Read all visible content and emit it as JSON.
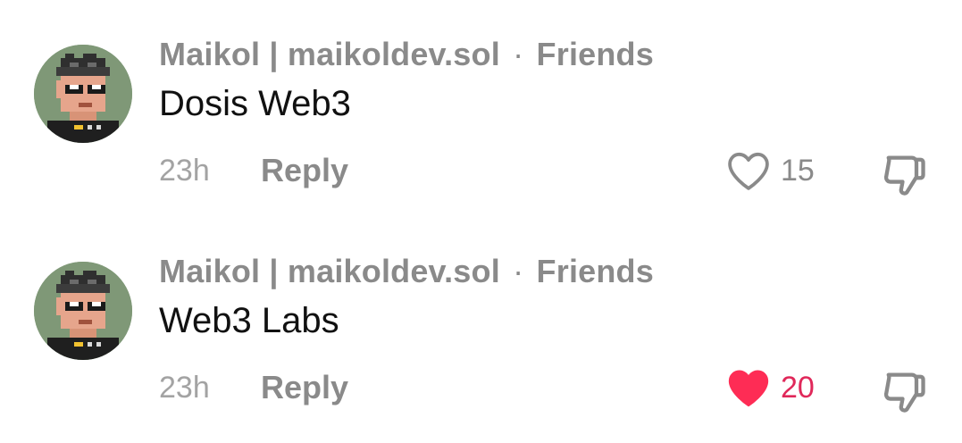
{
  "comments": [
    {
      "author": "Maikol | maikoldev.sol",
      "separator": "·",
      "relation": "Friends",
      "text": "Dosis Web3",
      "time": "23h",
      "reply_label": "Reply",
      "likes": "15",
      "liked": false,
      "avatar_icon": "pixel-art-avatar-icon",
      "like_icon": "heart-outline-icon",
      "dislike_icon": "thumbs-down-icon"
    },
    {
      "author": "Maikol | maikoldev.sol",
      "separator": "·",
      "relation": "Friends",
      "text": "Web3 Labs",
      "time": "23h",
      "reply_label": "Reply",
      "likes": "20",
      "liked": true,
      "avatar_icon": "pixel-art-avatar-icon",
      "like_icon": "heart-filled-icon",
      "dislike_icon": "thumbs-down-icon"
    }
  ],
  "colors": {
    "liked": "#fe2c55",
    "liked_count": "#e0285a",
    "muted": "#8a8a8a",
    "avatar_bg": "#7f9877"
  }
}
